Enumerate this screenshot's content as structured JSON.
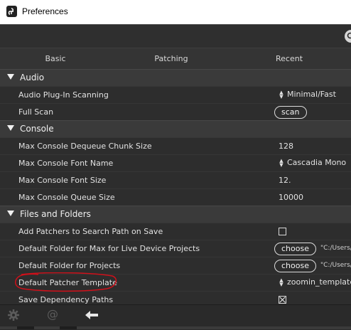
{
  "window": {
    "title": "Preferences"
  },
  "toolbar": {
    "search_icon": "search-icon"
  },
  "tabs": [
    {
      "label": "Basic"
    },
    {
      "label": "Patching"
    },
    {
      "label": "Recent"
    }
  ],
  "sections": {
    "audio": {
      "label": "Audio",
      "items": [
        {
          "label": "Audio Plug-In Scanning",
          "value": "Minimal/Fast"
        },
        {
          "label": "Full Scan",
          "button": "scan"
        }
      ]
    },
    "console": {
      "label": "Console",
      "items": [
        {
          "label": "Max Console Dequeue Chunk Size",
          "value": "128"
        },
        {
          "label": "Max Console Font Name",
          "value": "Cascadia Mono"
        },
        {
          "label": "Max Console Font Size",
          "value": "12."
        },
        {
          "label": "Max Console Queue Size",
          "value": "10000"
        }
      ]
    },
    "files": {
      "label": "Files and Folders",
      "items": [
        {
          "label": "Add Patchers to Search Path on Save",
          "checked": false
        },
        {
          "label": "Default Folder for Max for Live Device Projects",
          "button": "choose",
          "path": "\"C:/Users/o"
        },
        {
          "label": "Default Folder for Projects",
          "button": "choose",
          "path": "\"C:/Users/o"
        },
        {
          "label": "Default Patcher Template",
          "value": "zoomin_template"
        },
        {
          "label": "Save Dependency Paths",
          "checked": true
        }
      ]
    }
  },
  "annotation_color": "#d0101a",
  "footer": {
    "icons": [
      "gear-icon",
      "at-icon",
      "back-arrow-icon"
    ]
  }
}
